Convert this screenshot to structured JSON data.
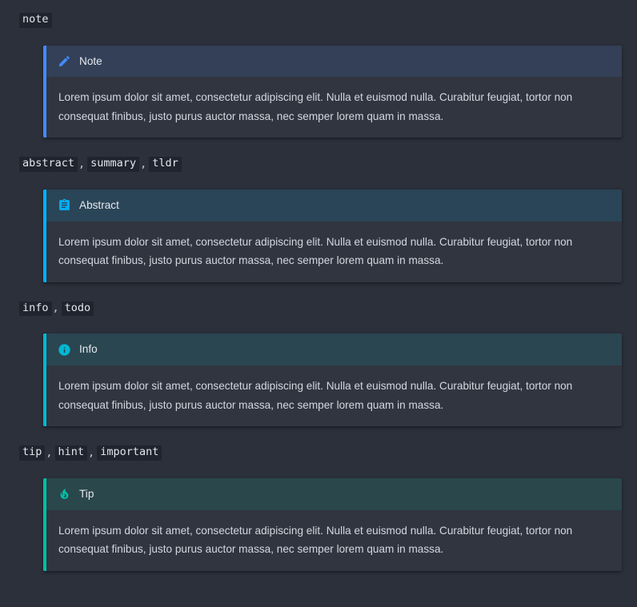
{
  "theme": {
    "page_background": "#2b303b",
    "admonition_background": "#31353f",
    "code_chip_background": "#20242e",
    "body_text_color": "#d3d7e0",
    "title_text_color": "#e6e9ef"
  },
  "body_text": "Lorem ipsum dolor sit amet, consectetur adipiscing elit. Nulla et euismod nulla. Curabitur feugiat, tortor non consequat finibus, justo purus auctor massa, nec semper lorem quam in massa.",
  "sections": [
    {
      "keywords": [
        "note"
      ],
      "separator": ",",
      "admonition": {
        "type": "note",
        "title": "Note",
        "icon": "pencil-icon",
        "accent_color": "#448aff",
        "body": "Lorem ipsum dolor sit amet, consectetur adipiscing elit. Nulla et euismod nulla. Curabitur feugiat, tortor non consequat finibus, justo purus auctor massa, nec semper lorem quam in massa."
      }
    },
    {
      "keywords": [
        "abstract",
        "summary",
        "tldr"
      ],
      "separator": ",",
      "admonition": {
        "type": "abstract",
        "title": "Abstract",
        "icon": "clipboard-icon",
        "accent_color": "#00b0ff",
        "body": "Lorem ipsum dolor sit amet, consectetur adipiscing elit. Nulla et euismod nulla. Curabitur feugiat, tortor non consequat finibus, justo purus auctor massa, nec semper lorem quam in massa."
      }
    },
    {
      "keywords": [
        "info",
        "todo"
      ],
      "separator": ",",
      "admonition": {
        "type": "info",
        "title": "Info",
        "icon": "info-circle-icon",
        "accent_color": "#00b8d4",
        "body": "Lorem ipsum dolor sit amet, consectetur adipiscing elit. Nulla et euismod nulla. Curabitur feugiat, tortor non consequat finibus, justo purus auctor massa, nec semper lorem quam in massa."
      }
    },
    {
      "keywords": [
        "tip",
        "hint",
        "important"
      ],
      "separator": ",",
      "admonition": {
        "type": "tip",
        "title": "Tip",
        "icon": "flame-icon",
        "accent_color": "#00bfa5",
        "body": "Lorem ipsum dolor sit amet, consectetur adipiscing elit. Nulla et euismod nulla. Curabitur feugiat, tortor non consequat finibus, justo purus auctor massa, nec semper lorem quam in massa."
      }
    }
  ]
}
